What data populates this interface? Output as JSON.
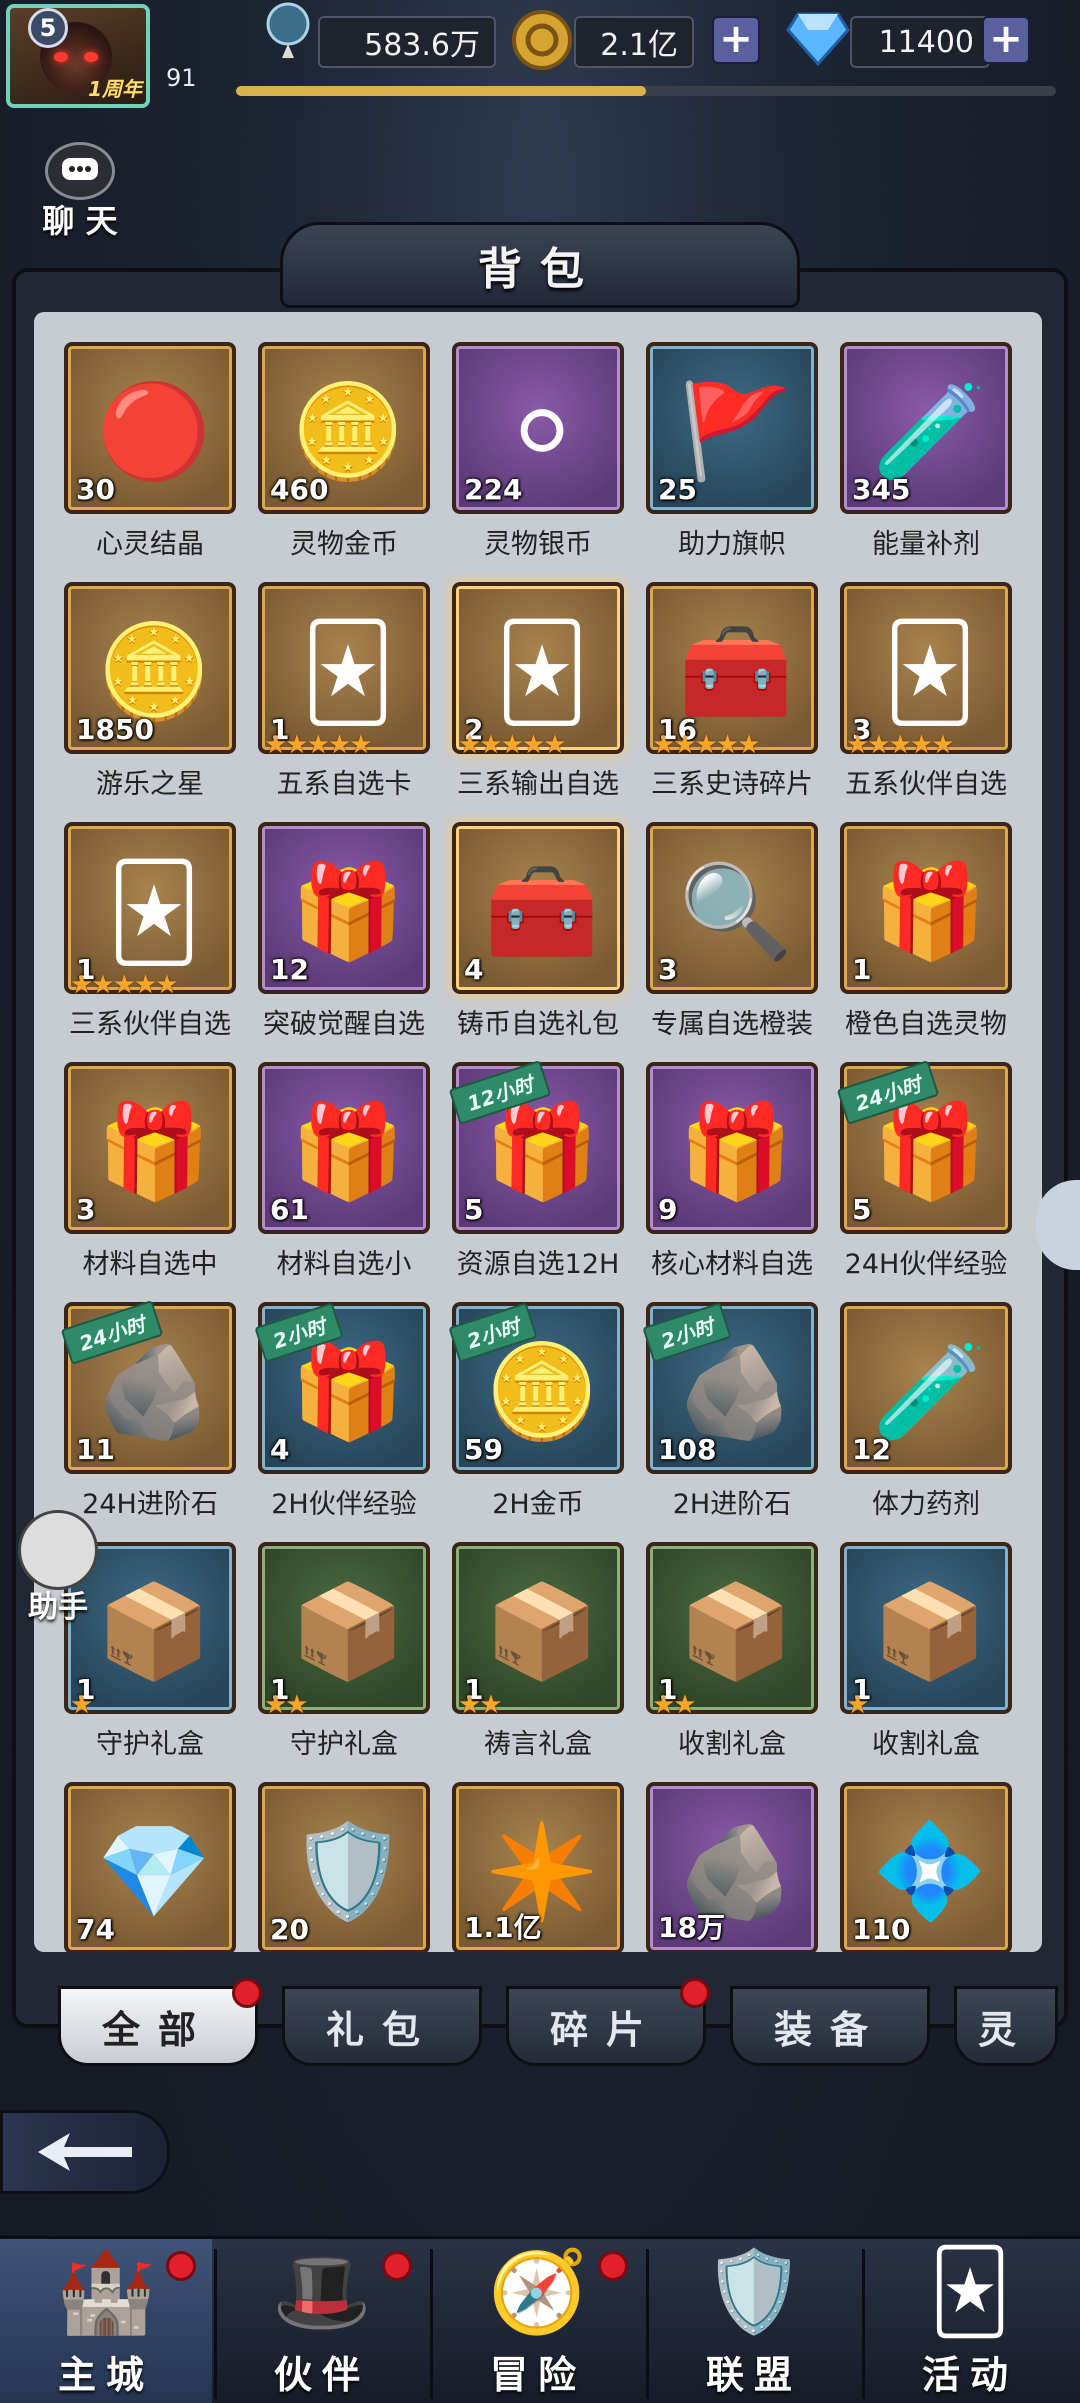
{
  "player": {
    "level_badge": "5",
    "level": "91",
    "anniversary_label": "1周年",
    "xp_progress": 0.5
  },
  "resources": {
    "power": "583.6万",
    "gold": "2.1亿",
    "diamonds": "11400"
  },
  "chat_label": "聊 天",
  "panel_title": "背包",
  "helper_label": "助手",
  "items": [
    {
      "name": "心灵结晶",
      "qty": "30",
      "frame": "gold",
      "icon": "red-crystal-icon",
      "emoji": "🔴"
    },
    {
      "name": "灵物金币",
      "qty": "460",
      "frame": "gold",
      "icon": "gold-coin-icon",
      "emoji": "🪙"
    },
    {
      "name": "灵物银币",
      "qty": "224",
      "frame": "purple",
      "icon": "silver-coin-icon",
      "emoji": "⚪"
    },
    {
      "name": "助力旗帜",
      "qty": "25",
      "frame": "blue",
      "icon": "red-flag-icon",
      "emoji": "🚩"
    },
    {
      "name": "能量补剂",
      "qty": "345",
      "frame": "purple",
      "icon": "green-potion-icon",
      "emoji": "🧪"
    },
    {
      "name": "游乐之星",
      "qty": "1850",
      "frame": "gold",
      "icon": "star-coin-icon",
      "emoji": "🪙"
    },
    {
      "name": "五系自选卡",
      "qty": "1",
      "frame": "gold",
      "icon": "card-icon",
      "emoji": "🃏",
      "stars": "★★★★★"
    },
    {
      "name": "三系输出自选",
      "qty": "2",
      "frame": "gold",
      "icon": "card-icon",
      "emoji": "🃏",
      "stars": "★★★★★",
      "glow": true
    },
    {
      "name": "三系史诗碎片",
      "qty": "16",
      "frame": "gold",
      "icon": "treasure-chest-icon",
      "emoji": "🧰",
      "stars": "★★★★★"
    },
    {
      "name": "五系伙伴自选",
      "qty": "3",
      "frame": "gold",
      "icon": "card-icon",
      "emoji": "🃏",
      "stars": "★★★★★"
    },
    {
      "name": "三系伙伴自选",
      "qty": "1",
      "frame": "gold",
      "icon": "card-icon",
      "emoji": "🃏",
      "stars": "★★★★★"
    },
    {
      "name": "突破觉醒自选",
      "qty": "12",
      "frame": "purple",
      "icon": "gift-box-icon",
      "emoji": "🎁"
    },
    {
      "name": "铸币自选礼包",
      "qty": "4",
      "frame": "gold",
      "icon": "chest-icon",
      "emoji": "🧰",
      "glow": true
    },
    {
      "name": "专属自选橙装",
      "qty": "3",
      "frame": "gold",
      "icon": "magnifier-icon",
      "emoji": "🔍"
    },
    {
      "name": "橙色自选灵物",
      "qty": "1",
      "frame": "gold",
      "icon": "gift-box-icon",
      "emoji": "🎁"
    },
    {
      "name": "材料自选中",
      "qty": "3",
      "frame": "gold",
      "icon": "material-box-icon",
      "emoji": "🎁"
    },
    {
      "name": "材料自选小",
      "qty": "61",
      "frame": "purple",
      "icon": "material-box-icon",
      "emoji": "🎁"
    },
    {
      "name": "资源自选12H",
      "qty": "5",
      "frame": "purple",
      "icon": "resource-box-icon",
      "emoji": "🎁",
      "ribbon": "12小时"
    },
    {
      "name": "核心材料自选",
      "qty": "9",
      "frame": "purple",
      "icon": "material-box-icon",
      "emoji": "🎁"
    },
    {
      "name": "24H伙伴经验",
      "qty": "5",
      "frame": "gold",
      "icon": "exp-box-icon",
      "emoji": "🎁",
      "ribbon": "24小时"
    },
    {
      "name": "24H进阶石",
      "qty": "11",
      "frame": "gold",
      "icon": "advance-stone-icon",
      "emoji": "🪨",
      "ribbon": "24小时"
    },
    {
      "name": "2H伙伴经验",
      "qty": "4",
      "frame": "blue",
      "icon": "exp-box-icon",
      "emoji": "🎁",
      "ribbon": "2小时"
    },
    {
      "name": "2H金币",
      "qty": "59",
      "frame": "blue",
      "icon": "coin-pile-icon",
      "emoji": "🪙",
      "ribbon": "2小时"
    },
    {
      "name": "2H进阶石",
      "qty": "108",
      "frame": "blue",
      "icon": "advance-stone-icon",
      "emoji": "🪨",
      "ribbon": "2小时"
    },
    {
      "name": "体力药剂",
      "qty": "12",
      "frame": "gold",
      "icon": "stamina-vial-icon",
      "emoji": "🧪"
    },
    {
      "name": "守护礼盒",
      "qty": "1",
      "frame": "blue",
      "icon": "guardian-box-icon",
      "emoji": "📦",
      "stars": "★"
    },
    {
      "name": "守护礼盒",
      "qty": "1",
      "frame": "green",
      "icon": "guardian-box-icon",
      "emoji": "📦",
      "stars": "★★"
    },
    {
      "name": "祷言礼盒",
      "qty": "1",
      "frame": "green",
      "icon": "prayer-box-icon",
      "emoji": "📦",
      "stars": "★★"
    },
    {
      "name": "收割礼盒",
      "qty": "1",
      "frame": "green",
      "icon": "harvest-box-icon",
      "emoji": "📦",
      "stars": "★★"
    },
    {
      "name": "收割礼盒",
      "qty": "1",
      "frame": "blue",
      "icon": "harvest-box-icon",
      "emoji": "📦",
      "stars": "★"
    },
    {
      "name": "",
      "qty": "74",
      "frame": "gold",
      "icon": "coffin-crystal-icon",
      "emoji": "💎"
    },
    {
      "name": "",
      "qty": "20",
      "frame": "gold",
      "icon": "golden-shield-icon",
      "emoji": "🛡️"
    },
    {
      "name": "",
      "qty": "1.1亿",
      "frame": "gold",
      "icon": "exp-star-icon",
      "emoji": "✴️"
    },
    {
      "name": "",
      "qty": "18万",
      "frame": "purple",
      "icon": "ore-icon",
      "emoji": "🪨"
    },
    {
      "name": "",
      "qty": "110",
      "frame": "gold",
      "icon": "blue-gem-icon",
      "emoji": "💠"
    }
  ],
  "tabs": [
    {
      "label": "全部",
      "dot": true
    },
    {
      "label": "礼包",
      "dot": false
    },
    {
      "label": "碎片",
      "dot": true
    },
    {
      "label": "装备",
      "dot": false
    },
    {
      "label": "灵",
      "dot": false
    }
  ],
  "bottom_nav": [
    {
      "label": "主城",
      "icon": "castle-icon",
      "glyph": "🏰",
      "dot": true
    },
    {
      "label": "伙伴",
      "icon": "wizard-hat-icon",
      "glyph": "🎩",
      "dot": true
    },
    {
      "label": "冒险",
      "icon": "compass-icon",
      "glyph": "🧭",
      "dot": true
    },
    {
      "label": "联盟",
      "icon": "shield-emblem-icon",
      "glyph": "🛡️",
      "dot": false
    },
    {
      "label": "活动",
      "icon": "cards-icon",
      "glyph": "🃏",
      "dot": false
    }
  ]
}
